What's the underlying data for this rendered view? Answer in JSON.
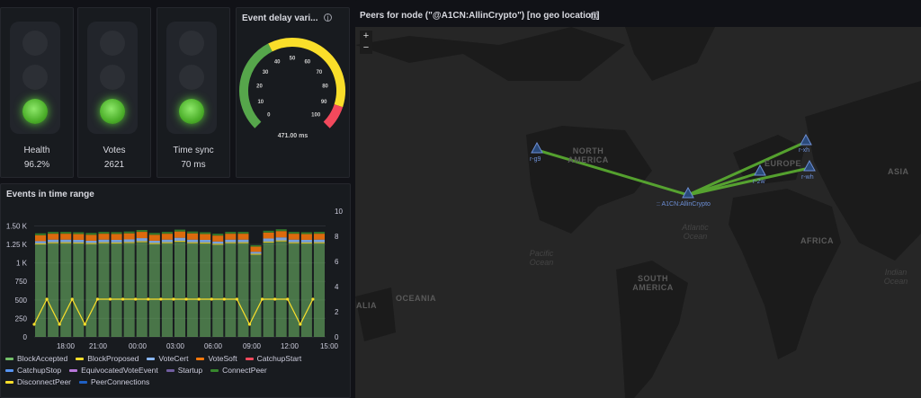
{
  "status_panels": [
    {
      "label": "Health",
      "value": "96.2%",
      "state": "green"
    },
    {
      "label": "Votes",
      "value": "2621",
      "state": "green"
    },
    {
      "label": "Time sync",
      "value": "70 ms",
      "state": "green"
    }
  ],
  "gauge": {
    "title": "Event delay vari...",
    "value": "471.00 ms",
    "ticks": [
      "0",
      "10",
      "20",
      "30",
      "40",
      "50",
      "60",
      "70",
      "80",
      "90",
      "100"
    ],
    "colors": {
      "green": "#56a64b",
      "yellow": "#fade2a",
      "red": "#f2495c"
    }
  },
  "map": {
    "title": "Peers for node (\"@A1CN:AllinCrypto\") [no geo location]",
    "zoom_in": "+",
    "zoom_out": "−",
    "continents": [
      "NORTH AMERICA",
      "SOUTH AMERICA",
      "EUROPE",
      "AFRICA",
      "ASIA",
      "OCEANIA",
      "ALIA"
    ],
    "oceans": [
      "Pacific Ocean",
      "Atlantic Ocean",
      "Indian Ocean"
    ],
    "peers": [
      "r-g9",
      "r-2w",
      "r-xh",
      "r-wh"
    ],
    "node": ":: A1CN:AllinCrypto",
    "link_color": "#5fb832"
  },
  "chart_data": {
    "type": "bar",
    "title": "Events in time range",
    "x_tick_labels": [
      "18:00",
      "21:00",
      "00:00",
      "03:00",
      "06:00",
      "09:00",
      "12:00",
      "15:00"
    ],
    "y_left_ticks": [
      "0",
      "250",
      "500",
      "750",
      "1 K",
      "1.25 K",
      "1.50 K"
    ],
    "y_right_ticks": [
      "0",
      "2",
      "4",
      "6",
      "8",
      "10"
    ],
    "ylim_left": [
      0,
      1700
    ],
    "ylim_right": [
      0,
      10
    ],
    "bar_series": [
      {
        "name": "BlockAccepted",
        "color": "#73bf69",
        "values": [
          1250,
          1265,
          1265,
          1262,
          1255,
          1265,
          1262,
          1268,
          1280,
          1255,
          1265,
          1285,
          1265,
          1262,
          1245,
          1265,
          1265,
          1110,
          1275,
          1290,
          1265,
          1262,
          1265
        ]
      },
      {
        "name": "BlockProposed",
        "color": "#fade2a",
        "values": [
          15,
          15,
          15,
          15,
          15,
          15,
          15,
          15,
          15,
          15,
          15,
          15,
          15,
          15,
          15,
          15,
          15,
          15,
          15,
          15,
          15,
          15,
          15
        ]
      },
      {
        "name": "VoteCert",
        "color": "#8ab8ff",
        "values": [
          30,
          35,
          35,
          35,
          30,
          35,
          35,
          35,
          40,
          30,
          35,
          40,
          35,
          35,
          30,
          35,
          35,
          25,
          40,
          40,
          35,
          35,
          35
        ]
      },
      {
        "name": "VoteSoft",
        "color": "#ff780a",
        "values": [
          80,
          80,
          80,
          78,
          80,
          80,
          80,
          82,
          85,
          80,
          80,
          85,
          85,
          78,
          80,
          80,
          80,
          70,
          80,
          85,
          80,
          78,
          80
        ]
      },
      {
        "name": "CatchupStart",
        "color": "#f2495c",
        "values": [
          0,
          0,
          0,
          0,
          0,
          0,
          0,
          0,
          0,
          0,
          0,
          0,
          0,
          0,
          0,
          0,
          0,
          0,
          0,
          0,
          0,
          0,
          0
        ]
      },
      {
        "name": "CatchupStop",
        "color": "#5794f2",
        "values": [
          0,
          0,
          0,
          0,
          0,
          0,
          0,
          0,
          0,
          0,
          0,
          0,
          0,
          0,
          0,
          0,
          0,
          0,
          0,
          0,
          0,
          0,
          0
        ]
      },
      {
        "name": "EquivocatedVoteEvent",
        "color": "#b877d9",
        "values": [
          0,
          0,
          0,
          0,
          0,
          0,
          0,
          0,
          0,
          0,
          0,
          0,
          0,
          0,
          0,
          0,
          0,
          0,
          0,
          0,
          0,
          0,
          0
        ]
      },
      {
        "name": "Startup",
        "color": "#705da0",
        "values": [
          0,
          0,
          0,
          0,
          0,
          0,
          0,
          0,
          0,
          0,
          0,
          0,
          0,
          0,
          0,
          0,
          0,
          0,
          0,
          0,
          0,
          0,
          0
        ]
      },
      {
        "name": "ConnectPeer",
        "color": "#37872d",
        "values": [
          25,
          25,
          25,
          25,
          25,
          25,
          25,
          25,
          25,
          25,
          25,
          25,
          25,
          25,
          25,
          25,
          25,
          20,
          25,
          25,
          25,
          25,
          25
        ]
      }
    ],
    "line_series": [
      {
        "name": "DisconnectPeer",
        "color": "#fade2a",
        "axis": "right",
        "values": [
          1,
          3,
          1,
          3,
          1,
          3,
          3,
          3,
          3,
          3,
          3,
          3,
          3,
          3,
          3,
          3,
          3,
          1,
          3,
          3,
          3,
          1,
          3
        ]
      }
    ],
    "extra_legend": [
      {
        "name": "PeerConnections",
        "color": "#1f60c4"
      }
    ],
    "legend_placement": "bottom"
  }
}
